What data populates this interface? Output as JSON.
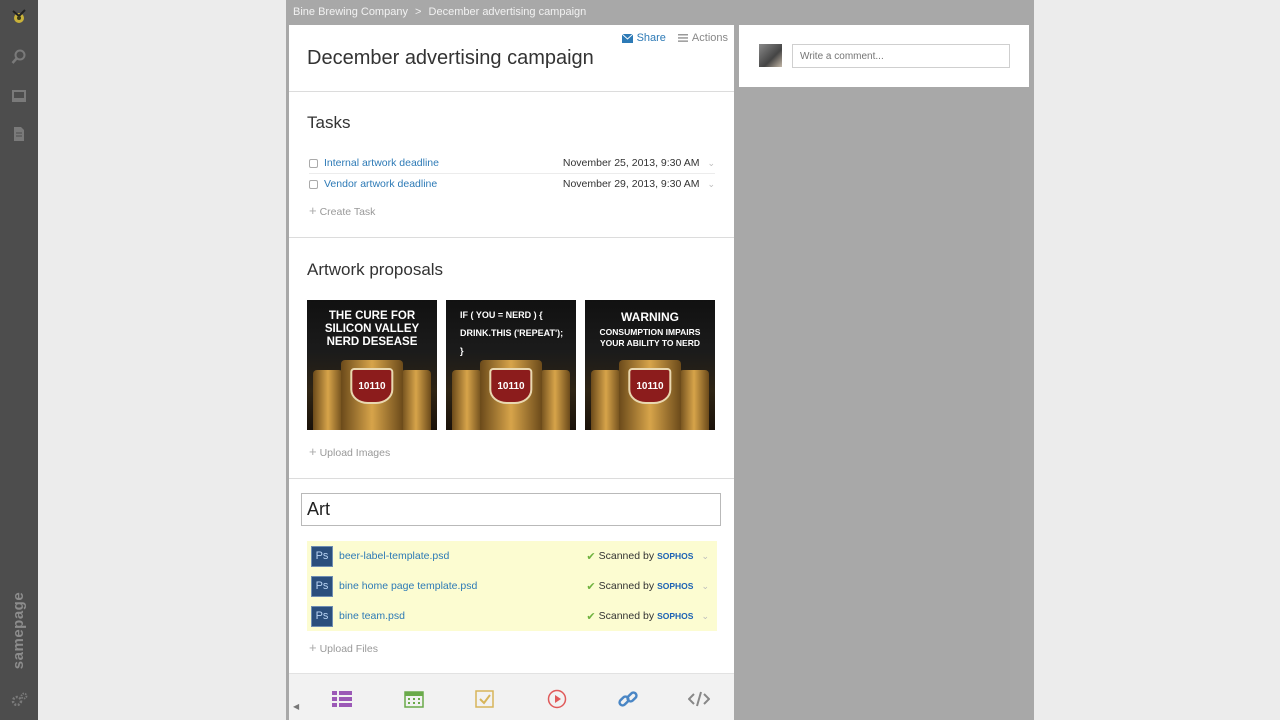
{
  "breadcrumb": {
    "company": "Bine Brewing Company",
    "separator": ">",
    "page": "December advertising campaign"
  },
  "header": {
    "share_label": "Share",
    "actions_label": "Actions",
    "title": "December advertising campaign"
  },
  "tasks": {
    "heading": "Tasks",
    "items": [
      {
        "name": "Internal artwork deadline",
        "date": "November 25, 2013, 9:30 AM"
      },
      {
        "name": "Vendor artwork deadline",
        "date": "November 29, 2013, 9:30 AM"
      }
    ],
    "create_label": "Create Task"
  },
  "artwork": {
    "heading": "Artwork proposals",
    "images": [
      {
        "line1": "THE CURE FOR",
        "line2": "SILICON VALLEY",
        "line3": "NERD DESEASE",
        "can_text": "10110"
      },
      {
        "line1": "IF ( YOU = NERD ) {",
        "line2": "DRINK.THIS ('REPEAT');",
        "line3": "}",
        "can_text": "10110"
      },
      {
        "line1": "WARNING",
        "line2": "CONSUMPTION IMPAIRS",
        "line3": "YOUR ABILITY TO NERD",
        "can_text": "10110"
      }
    ],
    "upload_label": "Upload Images"
  },
  "files": {
    "search_value": "Art",
    "items": [
      {
        "name": "beer-label-template.psd",
        "icon_text": "Ps",
        "scanned": "Scanned by",
        "vendor": "SOPHOS"
      },
      {
        "name": "bine home page template.psd",
        "icon_text": "Ps",
        "scanned": "Scanned by",
        "vendor": "SOPHOS"
      },
      {
        "name": "bine team.psd",
        "icon_text": "Ps",
        "scanned": "Scanned by",
        "vendor": "SOPHOS"
      }
    ],
    "upload_label": "Upload Files"
  },
  "comment": {
    "placeholder": "Write a comment..."
  },
  "rail": {
    "brand": "samepage"
  },
  "colors": {
    "link": "#2d7ab6",
    "file_highlight": "#fcfcd1",
    "rail": "#4d4d4d"
  }
}
